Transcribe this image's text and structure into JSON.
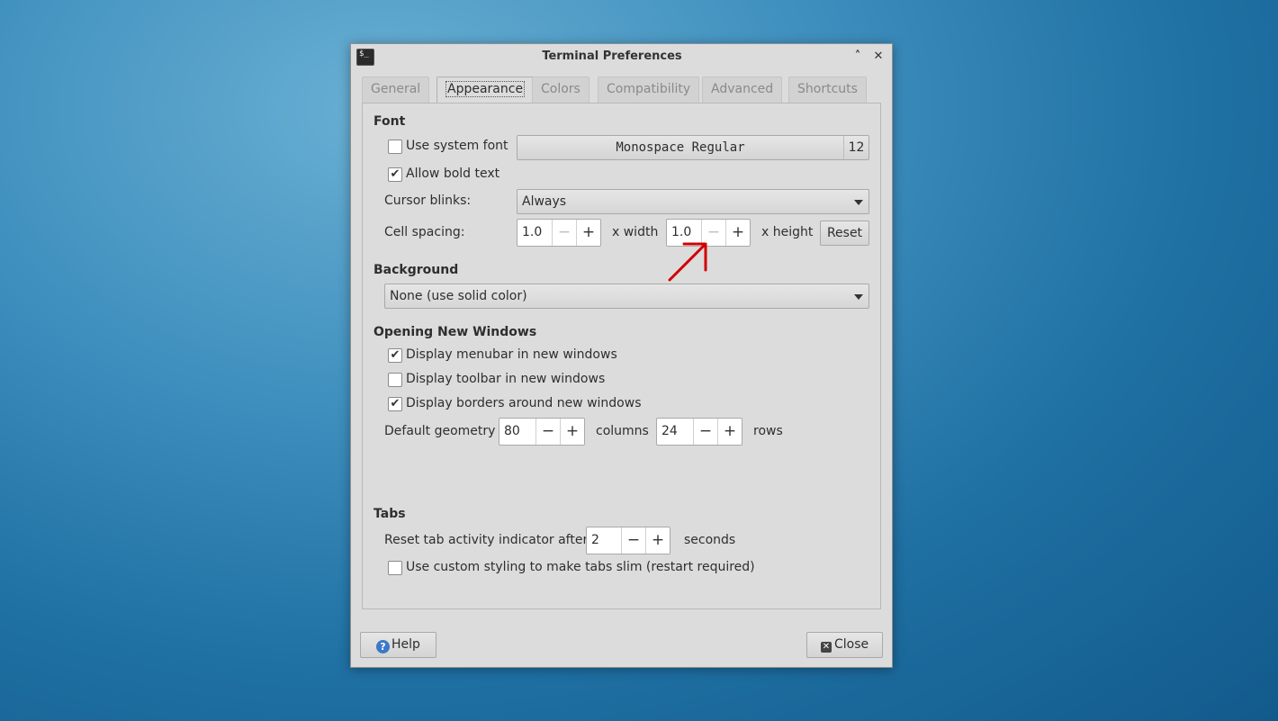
{
  "window": {
    "title": "Terminal Preferences"
  },
  "tabs": [
    "General",
    "Appearance",
    "Colors",
    "Compatibility",
    "Advanced",
    "Shortcuts"
  ],
  "font": {
    "section": "Font",
    "use_system_font": {
      "label": "Use system font",
      "checked": false
    },
    "font_name": "Monospace Regular",
    "font_size": "12",
    "allow_bold": {
      "label": "Allow bold text",
      "checked": true
    },
    "cursor_blinks_label": "Cursor blinks:",
    "cursor_blinks_value": "Always",
    "cell_spacing_label": "Cell spacing:",
    "width_value": "1.0",
    "width_suffix": "x width",
    "height_value": "1.0",
    "height_suffix": "x height",
    "reset_label": "Reset"
  },
  "background": {
    "section": "Background",
    "value": "None (use solid color)"
  },
  "new_windows": {
    "section": "Opening New Windows",
    "menubar": {
      "label": "Display menubar in new windows",
      "checked": true
    },
    "toolbar": {
      "label": "Display toolbar in new windows",
      "checked": false
    },
    "borders": {
      "label": "Display borders around new windows",
      "checked": true
    },
    "geometry_label": "Default geometry",
    "columns_value": "80",
    "columns_suffix": "columns",
    "rows_value": "24",
    "rows_suffix": "rows"
  },
  "tabs_section": {
    "section": "Tabs",
    "reset_activity_label": "Reset tab activity indicator after",
    "reset_activity_value": "2",
    "seconds_suffix": "seconds",
    "slim_tabs": {
      "label": "Use custom styling to make tabs slim (restart required)",
      "checked": false
    }
  },
  "buttons": {
    "help": "Help",
    "close": "Close"
  },
  "icons": {
    "app": "terminal-icon",
    "annotation": "red-arrow-annotation-icon",
    "accent": "#d10000"
  }
}
